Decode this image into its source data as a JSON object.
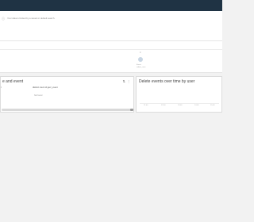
{
  "notice": {
    "icon": "info-icon",
    "text": "Your data is limited by a saved or default search."
  },
  "timeline": {
    "top_label": "0",
    "caption": "Event",
    "subcaption": "admin_user"
  },
  "left_panel": {
    "title": "e and event",
    "tools": [
      "filter-icon",
      "more-icon"
    ],
    "columns": {
      "left": "r",
      "right": "distinct count of gerc_event"
    },
    "cell_value": "Not found"
  },
  "right_panel": {
    "title": "Delete events over time by user",
    "ticks": [
      "11:00",
      "12:00",
      "13:00",
      "14:00",
      "15:00"
    ]
  }
}
